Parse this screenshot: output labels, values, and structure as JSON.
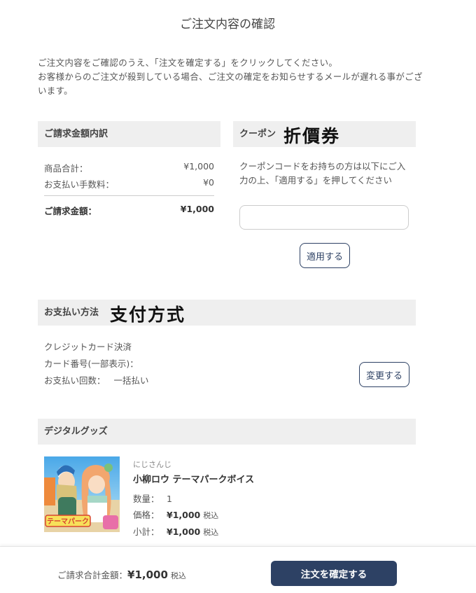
{
  "page": {
    "title": "ご注文内容の確認",
    "intro": [
      "ご注文内容をご確認のうえ、「注文を確定する」をクリックしてください。",
      "お客様からのご注文が殺到している場合、ご注文の確定をお知らせするメールが遅れる事がございます。"
    ]
  },
  "billing": {
    "heading": "ご請求金額内訳",
    "subtotal_label": "商品合計：",
    "subtotal_value": "¥1,000",
    "fee_label": "お支払い手数料：",
    "fee_value": "¥0",
    "total_label": "ご請求金額：",
    "total_value": "¥1,000"
  },
  "coupon": {
    "heading": "クーポン",
    "overlay_text": "折價券",
    "description": "クーポンコードをお持ちの方は以下にご入力の上、「適用する」を押してください",
    "input_value": "",
    "apply_label": "適用する"
  },
  "payment": {
    "heading": "お支払い方法",
    "overlay_text": "支付方式",
    "method": "クレジットカード決済",
    "card_label": "カード番号(一部表示)：",
    "installments_label": "お支払い回数：",
    "installments_value": "一括払い",
    "change_label": "変更する"
  },
  "goods": {
    "heading": "デジタルグッズ",
    "item": {
      "brand": "にじさんじ",
      "name": "小柳ロウ テーマパークボイス",
      "thumbnail_text": "テーマパーク",
      "qty_label": "数量：",
      "qty_value": "1",
      "price_label": "価格：",
      "price_value": "¥1,000",
      "subtotal_label": "小計：",
      "subtotal_value": "¥1,000",
      "tax_label": "税込"
    }
  },
  "footer": {
    "total_label": "ご請求合計金額：",
    "total_value": "¥1,000",
    "tax_label": "税込",
    "confirm_label": "注文を確定する"
  },
  "colors": {
    "accent": "#2d4164",
    "section_bg": "#efefef"
  }
}
